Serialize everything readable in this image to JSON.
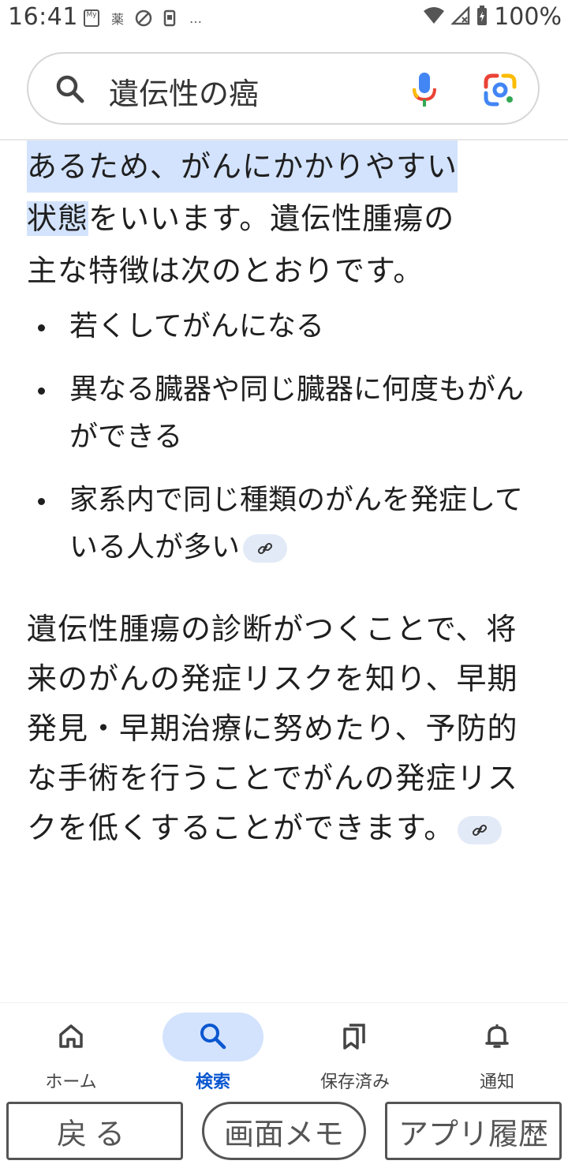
{
  "status_bar": {
    "time": "16:41",
    "left_icons": [
      "my-au-icon",
      "pharmacy-icon",
      "app-notification-icon",
      "device-icon",
      "more-dots-icon"
    ],
    "left_icon_texts": [
      "My",
      "薬",
      "…"
    ],
    "battery_percent": "100%",
    "right_icons": [
      "wifi-icon",
      "signal-icon",
      "battery-icon"
    ]
  },
  "search": {
    "query": "遺伝性の癌"
  },
  "article": {
    "para1_highlighted_line": "あるため、がんにかかりやすい",
    "para1_highlighted_word": "状態",
    "para1_rest_line2": "をいいます。遺伝性腫瘍の",
    "para1_line3": "主な特徴は次のとおりです。",
    "bullets": [
      {
        "text": "若くしてがんになる",
        "has_link": false
      },
      {
        "text": "異なる臓器や同じ臓器に何度もがんができる",
        "has_link": false
      },
      {
        "text": "家系内で同じ種類のがんを発症している人が多い",
        "has_link": true
      }
    ],
    "para2": "遺伝性腫瘍の診断がつくことで、将来のがんの発症リスクを知り、早期発見・早期治療に努めたり、予防的な手術を行うことでがんの発症リスクを低くすることができます。"
  },
  "bottom_nav": {
    "items": [
      {
        "label": "ホーム",
        "icon": "home-icon",
        "active": false
      },
      {
        "label": "検索",
        "icon": "search-icon",
        "active": true
      },
      {
        "label": "保存済み",
        "icon": "bookmarks-icon",
        "active": false
      },
      {
        "label": "通知",
        "icon": "bell-icon",
        "active": false
      }
    ]
  },
  "system_buttons": {
    "back": "戻る",
    "memo": "画面メモ",
    "recent_apps": "アプリ履歴"
  },
  "colors": {
    "highlight": "#d3e3fd",
    "accent": "#0b57d0",
    "text": "#1f1f1f"
  }
}
